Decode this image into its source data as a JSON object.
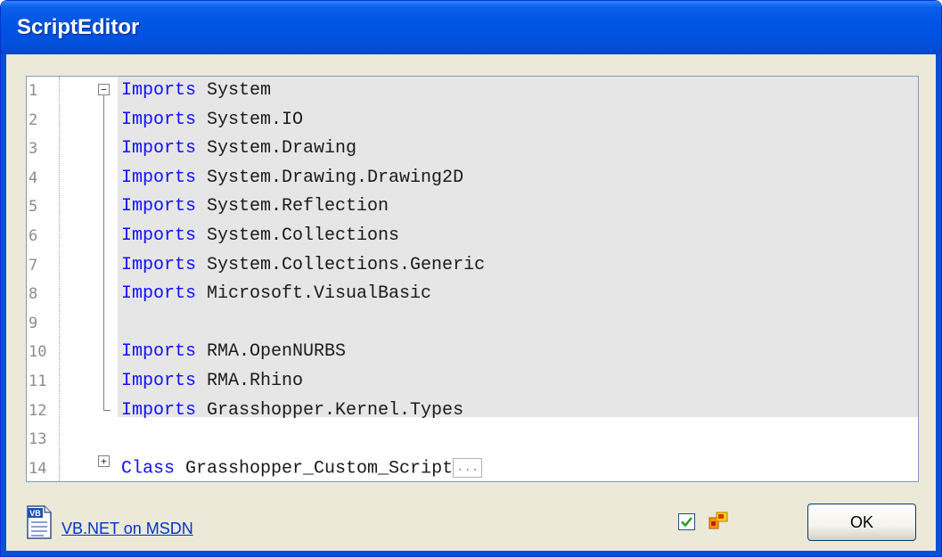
{
  "window": {
    "title": "ScriptEditor"
  },
  "editor": {
    "lines": [
      {
        "num": "1",
        "kw": "Imports",
        "rest": " System"
      },
      {
        "num": "2",
        "kw": "Imports",
        "rest": " System.IO"
      },
      {
        "num": "3",
        "kw": "Imports",
        "rest": " System.Drawing"
      },
      {
        "num": "4",
        "kw": "Imports",
        "rest": " System.Drawing.Drawing2D"
      },
      {
        "num": "5",
        "kw": "Imports",
        "rest": " System.Reflection"
      },
      {
        "num": "6",
        "kw": "Imports",
        "rest": " System.Collections"
      },
      {
        "num": "7",
        "kw": "Imports",
        "rest": " System.Collections.Generic"
      },
      {
        "num": "8",
        "kw": "Imports",
        "rest": " Microsoft.VisualBasic"
      },
      {
        "num": "9",
        "kw": "",
        "rest": ""
      },
      {
        "num": "10",
        "kw": "Imports",
        "rest": " RMA.OpenNURBS"
      },
      {
        "num": "11",
        "kw": "Imports",
        "rest": " RMA.Rhino"
      },
      {
        "num": "12",
        "kw": "Imports",
        "rest": " Grasshopper.Kernel.Types"
      },
      {
        "num": "13",
        "kw": "",
        "rest": ""
      },
      {
        "num": "14",
        "kw": "Class",
        "rest": " Grasshopper_Custom_Script"
      }
    ],
    "collapsed_marker": "...",
    "fold_expanded_symbol": "−",
    "fold_collapsed_symbol": "+"
  },
  "footer": {
    "help_link": "VB.NET on MSDN",
    "ok_label": "OK",
    "icons": [
      "vb-file-icon",
      "checkbox-icon",
      "flag-icon"
    ]
  },
  "colors": {
    "titlebar": "#0054e3",
    "keyword": "#1010ff",
    "code_background": "#e6e6e6",
    "link": "#0033cc"
  }
}
